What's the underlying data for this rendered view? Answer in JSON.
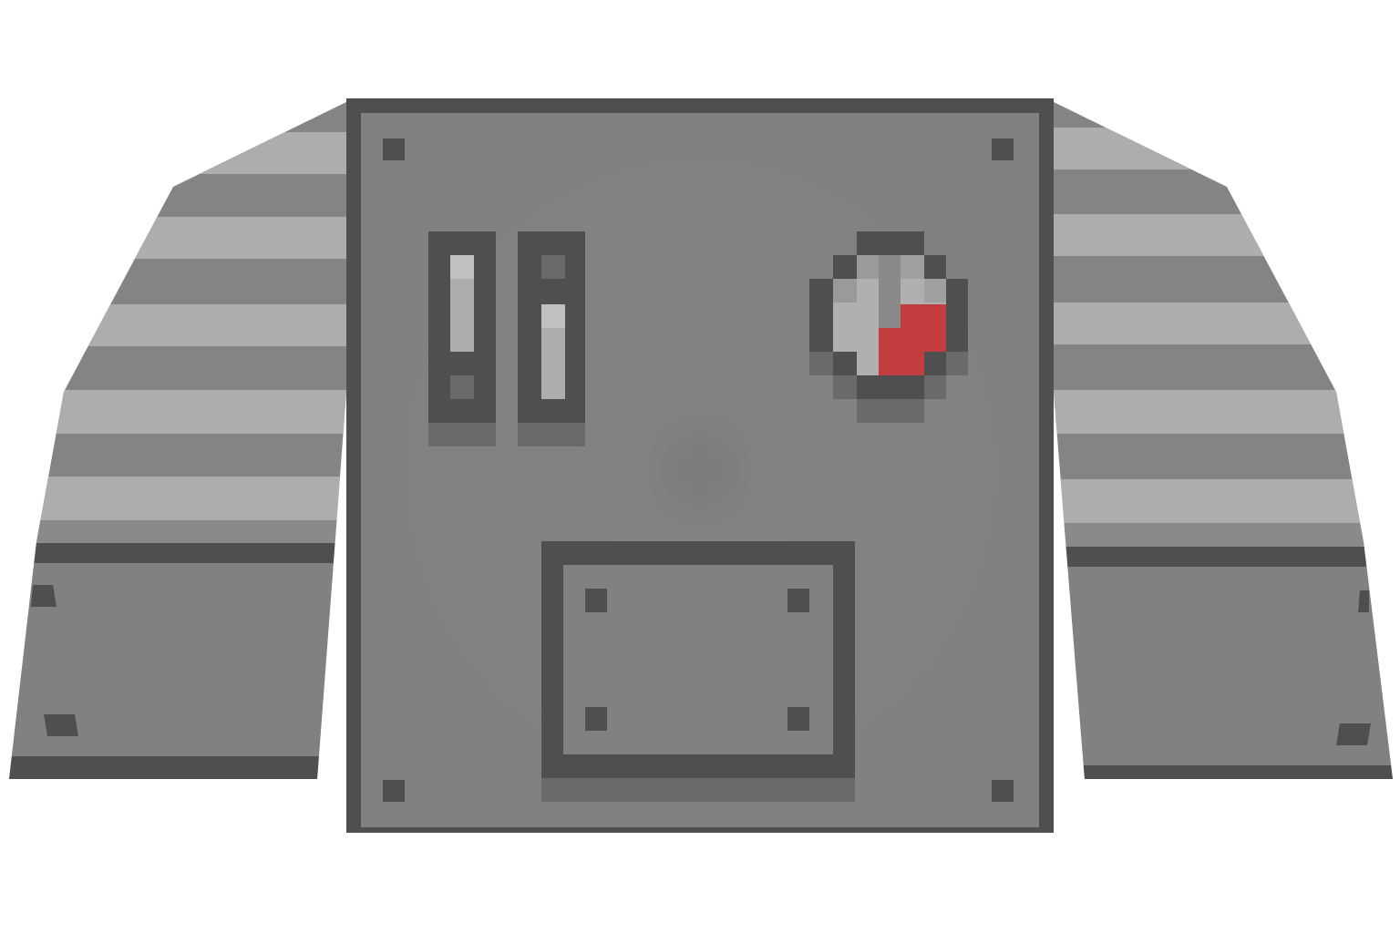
{
  "image": {
    "subject": "pixel-art-armor-vest-icon",
    "colors": {
      "background": "#ffffff",
      "outline": "#4f4f4f",
      "body": "#818181",
      "stripe_light": "#adadad",
      "stripe_mid": "#848484",
      "shadow": "#6a6a6a",
      "rivet": "#4f4f4f",
      "gauge_face": "#b0b0b0",
      "gauge_needle": "#c33c3f"
    },
    "parts": {
      "left_sleeve": {
        "stripes": 5,
        "rivets": 2
      },
      "right_sleeve": {
        "stripes": 5,
        "rivets": 2
      },
      "chest_plate": {
        "corner_rivets": 4
      },
      "indicators": {
        "count": 2
      },
      "gauge": {
        "icon": "gauge-icon"
      },
      "pocket_panel": {
        "rivets": 4
      }
    }
  }
}
